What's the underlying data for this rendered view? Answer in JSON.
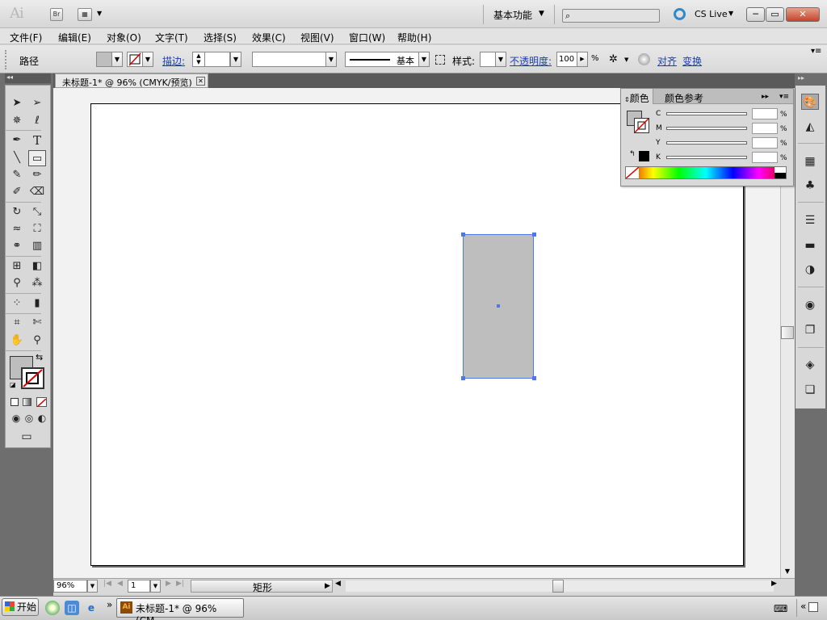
{
  "app": {
    "logo": "Ai",
    "bridge_btn": "Br",
    "workspace": "基本功能",
    "cs_live": "CS Live",
    "window_controls": {
      "minimize": "─",
      "restore": "▭",
      "close": "✕"
    }
  },
  "menu": [
    "文件(F)",
    "编辑(E)",
    "对象(O)",
    "文字(T)",
    "选择(S)",
    "效果(C)",
    "视图(V)",
    "窗口(W)",
    "帮助(H)"
  ],
  "control_bar": {
    "object_type": "路径",
    "stroke_label": "描边:",
    "stroke_profile": "基本",
    "style_label": "样式:",
    "opacity_label": "不透明度:",
    "opacity_value": "100",
    "opacity_unit": "%",
    "align_label": "对齐",
    "transform_label": "变换"
  },
  "document": {
    "tab_title": "未标题-1* @ 96% (CMYK/预览)",
    "zoom": "96%",
    "artboard_number": "1",
    "status_text": "矩形"
  },
  "color_panel": {
    "tabs": [
      "颜色",
      "颜色参考"
    ],
    "channels": [
      {
        "label": "C",
        "unit": "%"
      },
      {
        "label": "M",
        "unit": "%"
      },
      {
        "label": "Y",
        "unit": "%"
      },
      {
        "label": "K",
        "unit": "%"
      }
    ]
  },
  "colors": {
    "selection": "#4d79e0",
    "rect_fill": "#bebebe",
    "dock_gray": "#6e6e6e"
  },
  "taskbar": {
    "start_label": "开始",
    "task_item": "未标题-1* @ 96% (CM...",
    "chevron": "»"
  }
}
